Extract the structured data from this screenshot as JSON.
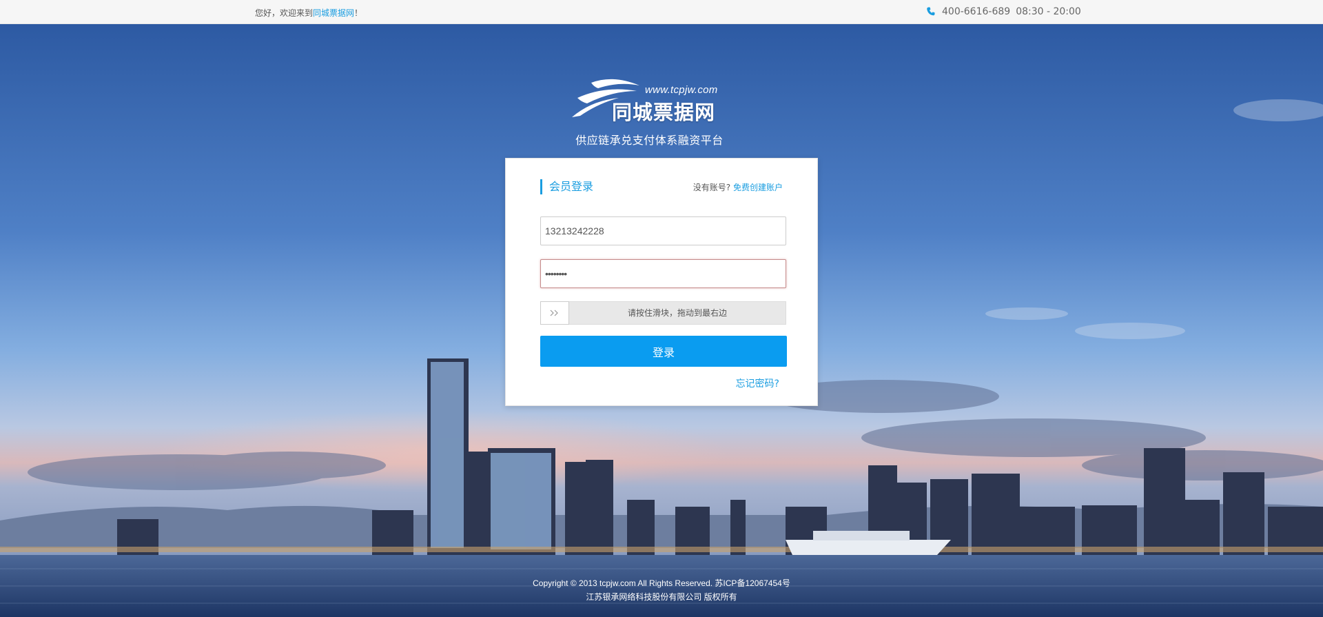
{
  "topbar": {
    "welcome_prefix": "您好，欢迎来到",
    "site_name": "同城票据网",
    "welcome_suffix": "！",
    "phone": "400-6616-689",
    "hours": "08:30 - 20:00"
  },
  "brand": {
    "url": "www.tcpjw.com",
    "name": "同城票据网",
    "tagline": "供应链承兑支付体系融资平台"
  },
  "login": {
    "title": "会员登录",
    "signup_prompt": "没有账号?",
    "signup_link": "免费创建账户",
    "username_value": "13213242228",
    "password_value": "••••••••",
    "slider_hint": "请按住滑块，拖动到最右边",
    "submit_label": "登录",
    "forgot_link": "忘记密码?"
  },
  "footer": {
    "copyright": "Copyright © 2013 tcpjw.com All Rights Reserved. 苏ICP备12067454号",
    "company": "江苏银承网络科技股份有限公司 版权所有"
  },
  "colors": {
    "accent": "#1a9de0",
    "button": "#0a9cf0"
  }
}
